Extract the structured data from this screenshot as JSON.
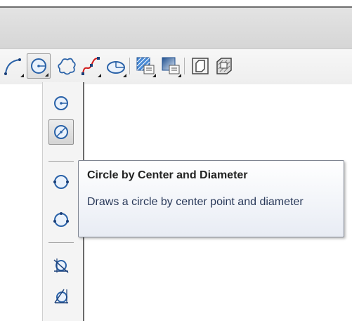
{
  "toolbar": {
    "buttons": [
      {
        "icon": "arc-icon"
      },
      {
        "icon": "circle-center-radius-icon",
        "active": true
      },
      {
        "icon": "revision-cloud-icon"
      },
      {
        "icon": "spline-icon"
      },
      {
        "icon": "ellipse-icon"
      },
      {
        "icon": "hatch-icon"
      },
      {
        "icon": "gradient-icon"
      },
      {
        "icon": "region-icon"
      },
      {
        "icon": "wipeout-icon"
      }
    ]
  },
  "flyout": {
    "items": [
      {
        "icon": "circle-center-radius-icon"
      },
      {
        "icon": "circle-center-diameter-icon",
        "active": true
      },
      {
        "icon": "circle-2-point-icon"
      },
      {
        "icon": "circle-3-point-icon"
      },
      {
        "icon": "circle-tan-tan-radius-icon"
      },
      {
        "icon": "circle-tan-tan-tan-icon"
      }
    ]
  },
  "tooltip": {
    "title": "Circle by Center and Diameter",
    "description": "Draws a circle by center point and diameter"
  },
  "colors": {
    "icon_blue": "#2a62a8",
    "icon_fill": "#cfe0f4",
    "spline_red": "#d11a1a",
    "tooltip_border": "#7f8591"
  }
}
